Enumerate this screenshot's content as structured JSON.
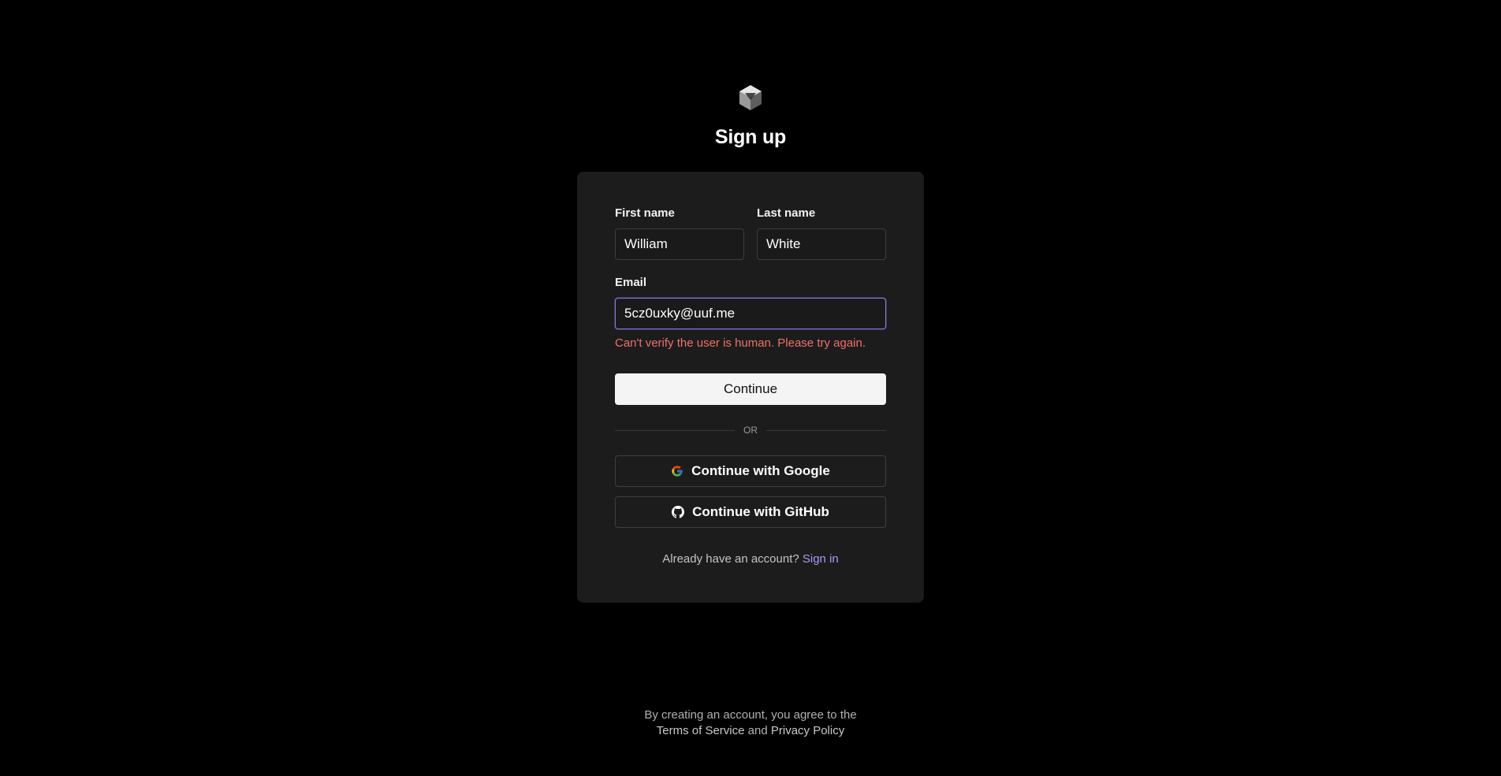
{
  "header": {
    "logo_icon": "cube-logo-icon",
    "title": "Sign up"
  },
  "form": {
    "first_name": {
      "label": "First name",
      "value": "William"
    },
    "last_name": {
      "label": "Last name",
      "value": "White"
    },
    "email": {
      "label": "Email",
      "value": "5cz0uxky@uuf.me"
    },
    "error_message": "Can't verify the user is human. Please try again.",
    "continue_label": "Continue",
    "divider_text": "OR",
    "google_label": "Continue with Google",
    "google_icon": "google-icon",
    "github_label": "Continue with GitHub",
    "github_icon": "github-icon",
    "signin_prompt": "Already have an account?",
    "signin_link": "Sign in"
  },
  "footer": {
    "line1": "By creating an account, you agree to the",
    "terms": "Terms of Service",
    "and": "and",
    "privacy": "Privacy Policy"
  },
  "colors": {
    "background": "#000000",
    "card": "#1c1c1c",
    "accent": "#8a7ae6",
    "error": "#f0716a",
    "link": "#a49cf3"
  }
}
